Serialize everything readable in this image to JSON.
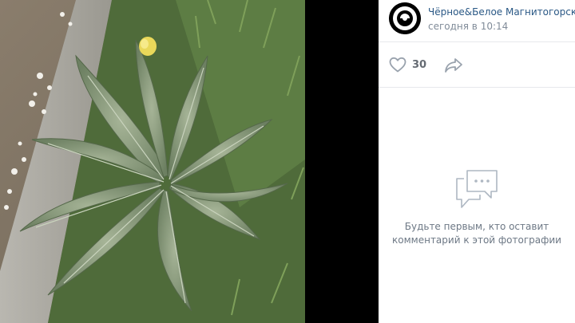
{
  "post": {
    "author": "Чёрное&Белое Магнитогорск",
    "time": "сегодня в 10:14"
  },
  "actions": {
    "likes": "30",
    "like_icon": "heart-icon",
    "share_icon": "share-icon"
  },
  "comments": {
    "empty_line1": "Будьте первым, кто оставит",
    "empty_line2": "комментарий к этой фотографии",
    "empty_icon": "comments-icon"
  },
  "colors": {
    "link": "#2a5885",
    "secondary_text": "#818c99",
    "icon_gray": "#99a2ad",
    "divider": "#e7e8ec"
  }
}
